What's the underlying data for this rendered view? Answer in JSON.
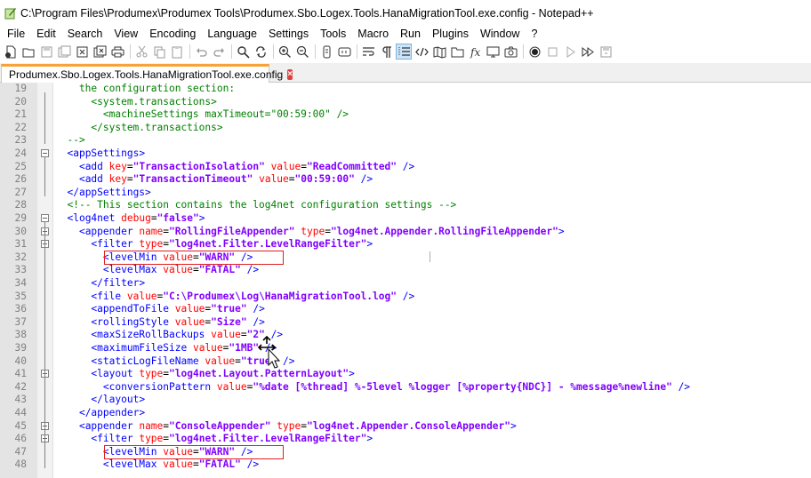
{
  "window": {
    "title": "C:\\Program Files\\Produmex\\Produmex Tools\\Produmex.Sbo.Logex.Tools.HanaMigrationTool.exe.config - Notepad++"
  },
  "menu": [
    "File",
    "Edit",
    "Search",
    "View",
    "Encoding",
    "Language",
    "Settings",
    "Tools",
    "Macro",
    "Run",
    "Plugins",
    "Window",
    "?"
  ],
  "toolbar": {
    "icons": [
      "new-file-icon",
      "open-file-icon",
      "save-icon",
      "save-all-icon",
      "close-icon",
      "close-all-icon",
      "print-icon",
      "cut-icon",
      "copy-icon",
      "paste-icon",
      "undo-icon",
      "redo-icon",
      "find-icon",
      "replace-icon",
      "zoom-in-icon",
      "zoom-out-icon",
      "sync-v-icon",
      "sync-h-icon",
      "word-wrap-icon",
      "show-all-chars-icon",
      "indent-guide-icon",
      "xml-tag-icon",
      "doc-map-icon",
      "folder-workspace-icon",
      "function-list-icon",
      "monitor-icon",
      "record-macro-icon",
      "stop-record-icon",
      "play-macro-icon",
      "run-macro-multiple-icon",
      "save-macro-icon"
    ]
  },
  "tab": {
    "label": "Produmex.Sbo.Logex.Tools.HanaMigrationTool.exe.config"
  },
  "lines": [
    {
      "n": "19",
      "code": "    the configuration section:"
    },
    {
      "n": "20",
      "code": "      <system.transactions>"
    },
    {
      "n": "21",
      "code": "        <machineSettings maxTimeout=\"00:59:00\" />"
    },
    {
      "n": "22",
      "code": "      </system.transactions>"
    },
    {
      "n": "23",
      "code": "  -->"
    },
    {
      "n": "24",
      "code": "  <appSettings>"
    },
    {
      "n": "25",
      "code": "    <add key=\"TransactionIsolation\" value=\"ReadCommitted\" />"
    },
    {
      "n": "26",
      "code": "    <add key=\"TransactionTimeout\" value=\"00:59:00\" />"
    },
    {
      "n": "27",
      "code": "  </appSettings>"
    },
    {
      "n": "28",
      "code": "  <!-- This section contains the log4net configuration settings -->"
    },
    {
      "n": "29",
      "code": "  <log4net debug=\"false\">"
    },
    {
      "n": "30",
      "code": "    <appender name=\"RollingFileAppender\" type=\"log4net.Appender.RollingFileAppender\">"
    },
    {
      "n": "31",
      "code": "      <filter type=\"log4net.Filter.LevelRangeFilter\">"
    },
    {
      "n": "32",
      "code": "        <levelMin value=\"WARN\" />"
    },
    {
      "n": "33",
      "code": "        <levelMax value=\"FATAL\" />"
    },
    {
      "n": "34",
      "code": "      </filter>"
    },
    {
      "n": "35",
      "code": "      <file value=\"C:\\Produmex\\Log\\HanaMigrationTool.log\" />"
    },
    {
      "n": "36",
      "code": "      <appendToFile value=\"true\" />"
    },
    {
      "n": "37",
      "code": "      <rollingStyle value=\"Size\" />"
    },
    {
      "n": "38",
      "code": "      <maxSizeRollBackups value=\"2\" />"
    },
    {
      "n": "39",
      "code": "      <maximumFileSize value=\"1MB\" />"
    },
    {
      "n": "40",
      "code": "      <staticLogFileName value=\"true\" />"
    },
    {
      "n": "41",
      "code": "      <layout type=\"log4net.Layout.PatternLayout\">"
    },
    {
      "n": "42",
      "code": "        <conversionPattern value=\"%date [%thread] %-5level %logger [%property{NDC}] - %message%newline\" />"
    },
    {
      "n": "43",
      "code": "      </layout>"
    },
    {
      "n": "44",
      "code": "    </appender>"
    },
    {
      "n": "45",
      "code": "    <appender name=\"ConsoleAppender\" type=\"log4net.Appender.ConsoleAppender\">"
    },
    {
      "n": "46",
      "code": "      <filter type=\"log4net.Filter.LevelRangeFilter\">"
    },
    {
      "n": "47",
      "code": "        <levelMin value=\"WARN\" />"
    },
    {
      "n": "48",
      "code": "        <levelMax value=\"FATAL\" />"
    }
  ],
  "highlighted_lines": [
    "32",
    "47"
  ],
  "colors": {
    "tag": "#0000ff",
    "attribute": "#ff0000",
    "value": "#8000ff",
    "comment": "#008000",
    "highlight_box": "#e02020",
    "tab_accent": "#f8a33a"
  }
}
